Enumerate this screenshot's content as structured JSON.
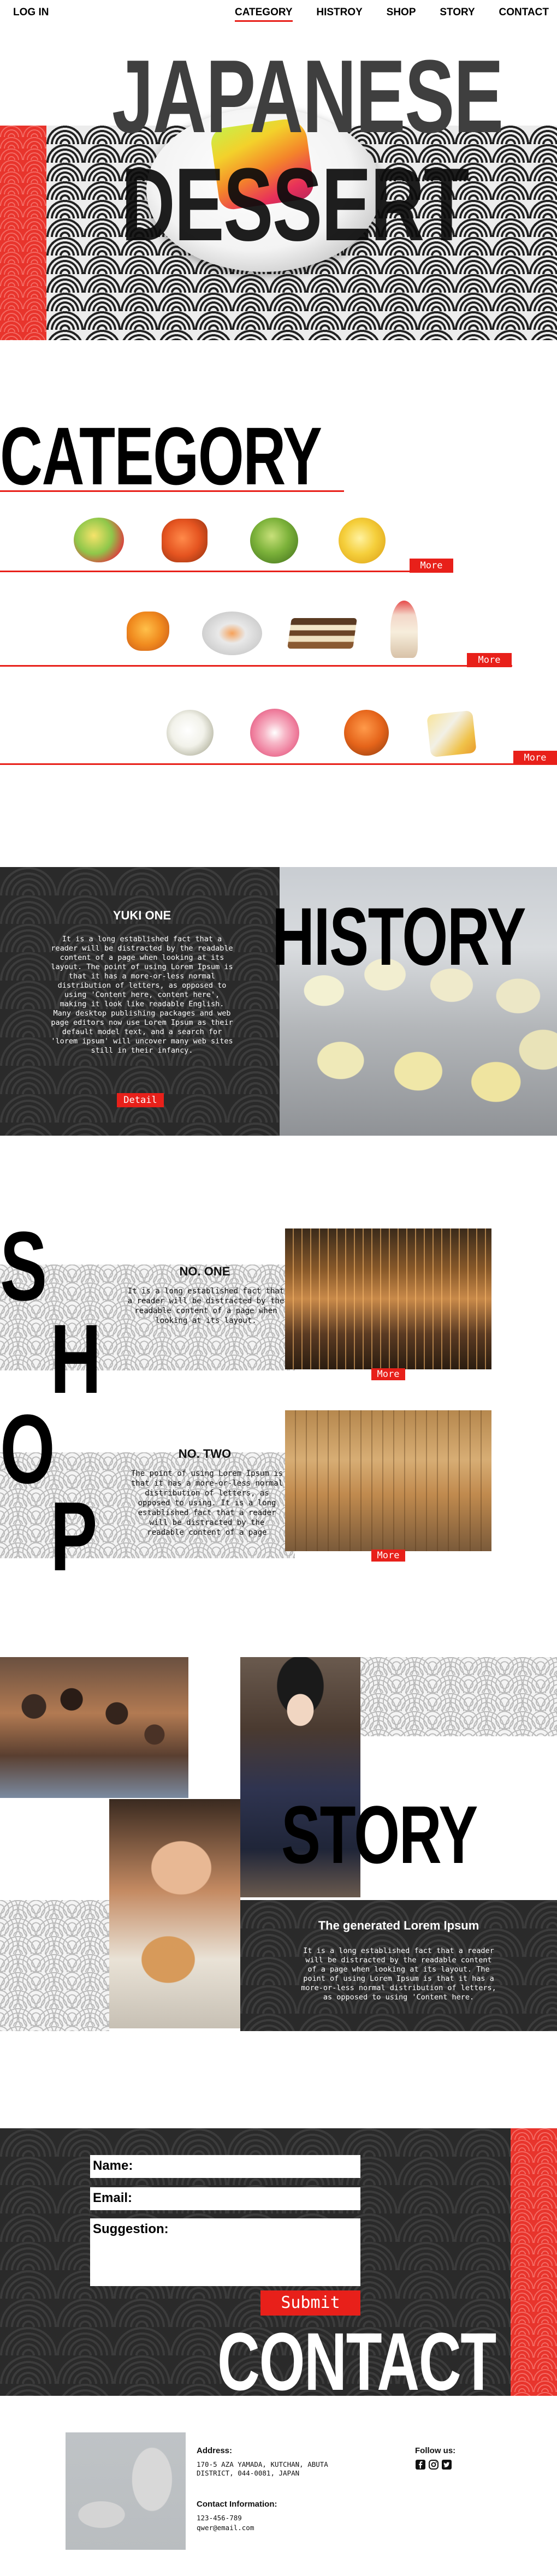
{
  "nav": {
    "login": "LOG IN",
    "links": [
      "CATEGORY",
      "HISTROY",
      "SHOP",
      "STORY",
      "CONTACT"
    ]
  },
  "hero": {
    "line1": "JAPANESE",
    "line2": "DESSERT"
  },
  "category": {
    "title": "CATEGORY",
    "more": "More"
  },
  "history": {
    "title": "HISTORY",
    "subtitle": "YUKI  ONE",
    "body": "It is a long established fact that a reader will be distracted by the readable content of a page when looking at its layout. The point of using Lorem Ipsum is that it has a more-or-less normal distribution of letters, as opposed to using 'Content here, content here', making it look like readable English. Many desktop publishing packages and web page editors now use Lorem Ipsum as their default model text, and a search for 'lorem ipsum' will uncover many web sites still in their infancy.",
    "button": "Detail"
  },
  "shop": {
    "letters": [
      "S",
      "H",
      "O",
      "P"
    ],
    "items": [
      {
        "title": "NO.  ONE",
        "body": "It is a long established fact that a reader will be distracted by the readable content of a page when looking at its layout.",
        "button": "More"
      },
      {
        "title": "NO.  TWO",
        "body": "The point of using Lorem Ipsum is that it has a more-or-less normal distribution of letters, as opposed to using. It is a long established fact that a reader will be distracted by the readable content of a page",
        "button": "More"
      }
    ]
  },
  "story": {
    "title": "STORY",
    "subtitle": "The  generated  Lorem  Ipsum",
    "body": "It is a long established fact that a reader will be distracted by the readable content of a page when looking at its layout. The point of using Lorem Ipsum is that it has a more-or-less normal distribution of letters, as opposed to using 'Content here."
  },
  "contact": {
    "title": "CONTACT",
    "name_label": "Name:",
    "email_label": "Email:",
    "suggestion_label": "Suggestion:",
    "submit": "Submit"
  },
  "footer": {
    "address_label": "Address:",
    "address": "170-5 AZA YAMADA, KUTCHAN, ABUTA DISTRICT, 044-0081, JAPAN",
    "contact_label": "Contact  Information:",
    "phone": "123-456-789",
    "email": "qwer@email.com",
    "follow_label": "Follow  us:"
  },
  "colors": {
    "accent": "#e8201a",
    "dark": "#2a2a2a"
  }
}
